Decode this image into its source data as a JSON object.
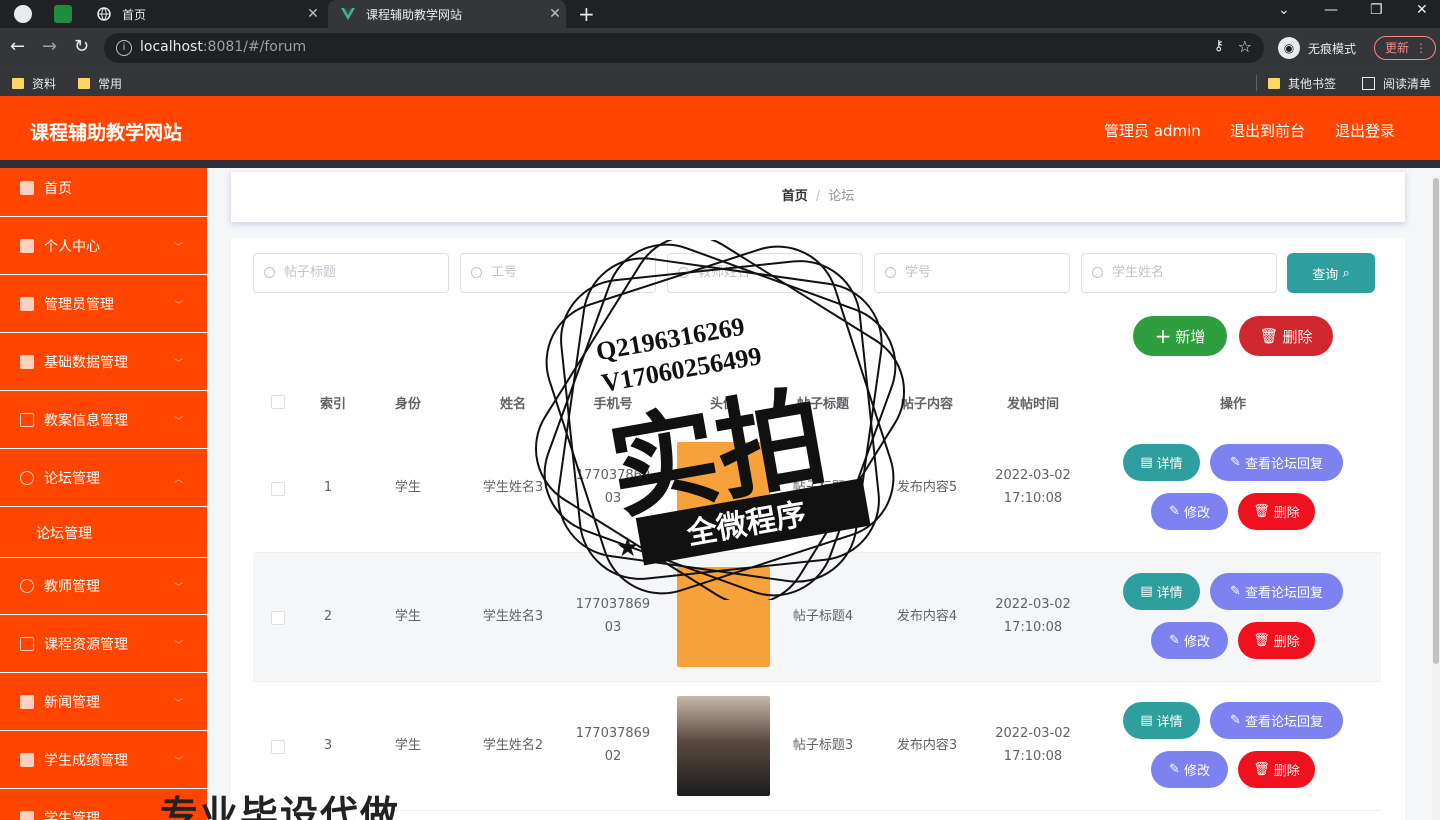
{
  "browser": {
    "tabs": [
      {
        "title": "首页"
      },
      {
        "title": "课程辅助教学网站"
      }
    ],
    "url_host": "localhost",
    "url_rest": ":8081/#/forum",
    "incognito_label": "无痕模式",
    "update_label": "更新",
    "bookmarks": [
      "资料",
      "常用"
    ],
    "bookmarks_right": [
      "其他书签",
      "阅读清单"
    ]
  },
  "header": {
    "title": "课程辅助教学网站",
    "user": "管理员 admin",
    "to_front": "退出到前台",
    "logout": "退出登录"
  },
  "sidebar": {
    "items": [
      {
        "label": "首页",
        "icon": "home-icon"
      },
      {
        "label": "个人中心",
        "icon": "user-icon"
      },
      {
        "label": "管理员管理",
        "icon": "grid-icon"
      },
      {
        "label": "基础数据管理",
        "icon": "user-icon"
      },
      {
        "label": "教案信息管理",
        "icon": "doc-icon"
      },
      {
        "label": "论坛管理",
        "icon": "chat-icon"
      },
      {
        "label": "论坛管理"
      },
      {
        "label": "教师管理",
        "icon": "teacher-icon"
      },
      {
        "label": "课程资源管理",
        "icon": "folder-icon"
      },
      {
        "label": "新闻管理",
        "icon": "flag-icon"
      },
      {
        "label": "学生成绩管理",
        "icon": "chart-icon"
      },
      {
        "label": "学生管理",
        "icon": "user-icon"
      }
    ]
  },
  "breadcrumb": {
    "home": "首页",
    "sep": "/",
    "current": "论坛"
  },
  "search": {
    "placeholders": [
      "帖子标题",
      "工号",
      "教师姓名",
      "学号",
      "学生姓名"
    ],
    "query_label": "查询"
  },
  "toolbar": {
    "add_label": "新增",
    "delete_label": "删除"
  },
  "table": {
    "headers": [
      "索引",
      "身份",
      "姓名",
      "手机号",
      "头像",
      "帖子标题",
      "帖子内容",
      "发帖时间",
      "操作"
    ],
    "rows": [
      {
        "index": "1",
        "role": "学生",
        "name": "学生姓名3",
        "phone1": "177037869",
        "phone2": "03",
        "title": "帖子标题5",
        "content": "发布内容5",
        "date": "2022-03-02",
        "time": "17:10:08"
      },
      {
        "index": "2",
        "role": "学生",
        "name": "学生姓名3",
        "phone1": "177037869",
        "phone2": "03",
        "title": "帖子标题4",
        "content": "发布内容4",
        "date": "2022-03-02",
        "time": "17:10:08"
      },
      {
        "index": "3",
        "role": "学生",
        "name": "学生姓名2",
        "phone1": "177037869",
        "phone2": "02",
        "title": "帖子标题3",
        "content": "发布内容3",
        "date": "2022-03-02",
        "time": "17:10:08"
      }
    ],
    "actions": {
      "detail": "详情",
      "reply": "查看论坛回复",
      "edit": "修改",
      "remove": "删除"
    }
  },
  "watermark": {
    "line1": "Q2196316269",
    "line2": "V17060256499",
    "big": "实拍",
    "ribbon": "全微程序",
    "bottom": "专业毕设代做"
  },
  "colors": {
    "brand": "#ff4500",
    "teal": "#2f9e9e",
    "purple": "#7c83f0",
    "red": "#f0101e",
    "green": "#2e9e3e"
  }
}
